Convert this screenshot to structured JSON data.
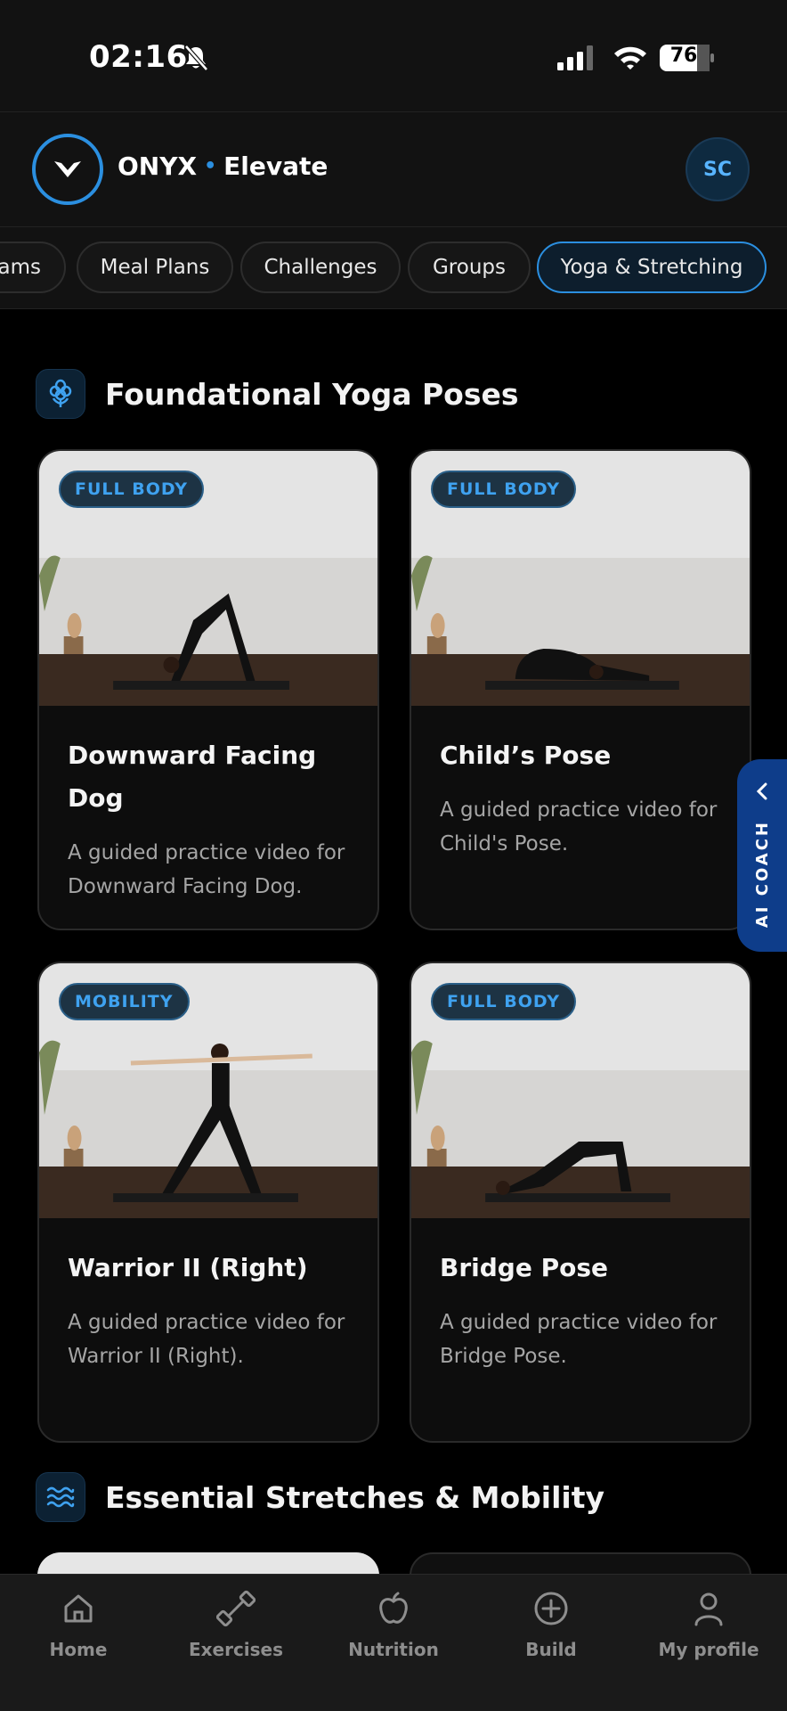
{
  "status_bar": {
    "time": "02:16",
    "battery": "76"
  },
  "header": {
    "brand_name": "ONYX",
    "brand_sep": "•",
    "brand_app": "Elevate",
    "avatar_initials": "SC"
  },
  "tabs": [
    "rams",
    "Meal Plans",
    "Challenges",
    "Groups",
    "Yoga & Stretching"
  ],
  "active_tab": "Yoga & Stretching",
  "sections": [
    {
      "title": "Foundational Yoga Poses",
      "icon": "flower-icon"
    },
    {
      "title": "Essential Stretches & Mobility",
      "icon": "waves-icon"
    }
  ],
  "cards": [
    {
      "badge": "FULL BODY",
      "title": "Downward Facing Dog",
      "desc": "A guided practice video for Downward Facing Dog.",
      "pose": "downward-dog"
    },
    {
      "badge": "FULL BODY",
      "title": "Child’s Pose",
      "desc": "A guided practice video for Child's Pose.",
      "pose": "child"
    },
    {
      "badge": "MOBILITY",
      "title": "Warrior II (Right)",
      "desc": "A guided practice video for Warrior II (Right).",
      "pose": "warrior"
    },
    {
      "badge": "FULL BODY",
      "title": "Bridge Pose",
      "desc": "A guided practice video for Bridge Pose.",
      "pose": "bridge"
    }
  ],
  "ai_coach": {
    "label": "AI COACH"
  },
  "bottom_nav": [
    {
      "label": "Home",
      "icon": "home-icon"
    },
    {
      "label": "Exercises",
      "icon": "dumbbell-icon"
    },
    {
      "label": "Nutrition",
      "icon": "apple-icon"
    },
    {
      "label": "Build",
      "icon": "plus-circle-icon"
    },
    {
      "label": "My profile",
      "icon": "user-icon"
    }
  ],
  "colors": {
    "accent": "#2b8fe0",
    "background": "#000000",
    "surface": "#121212",
    "badge_text": "#3fa2f0",
    "coach_bg": "#0e3d8a"
  }
}
